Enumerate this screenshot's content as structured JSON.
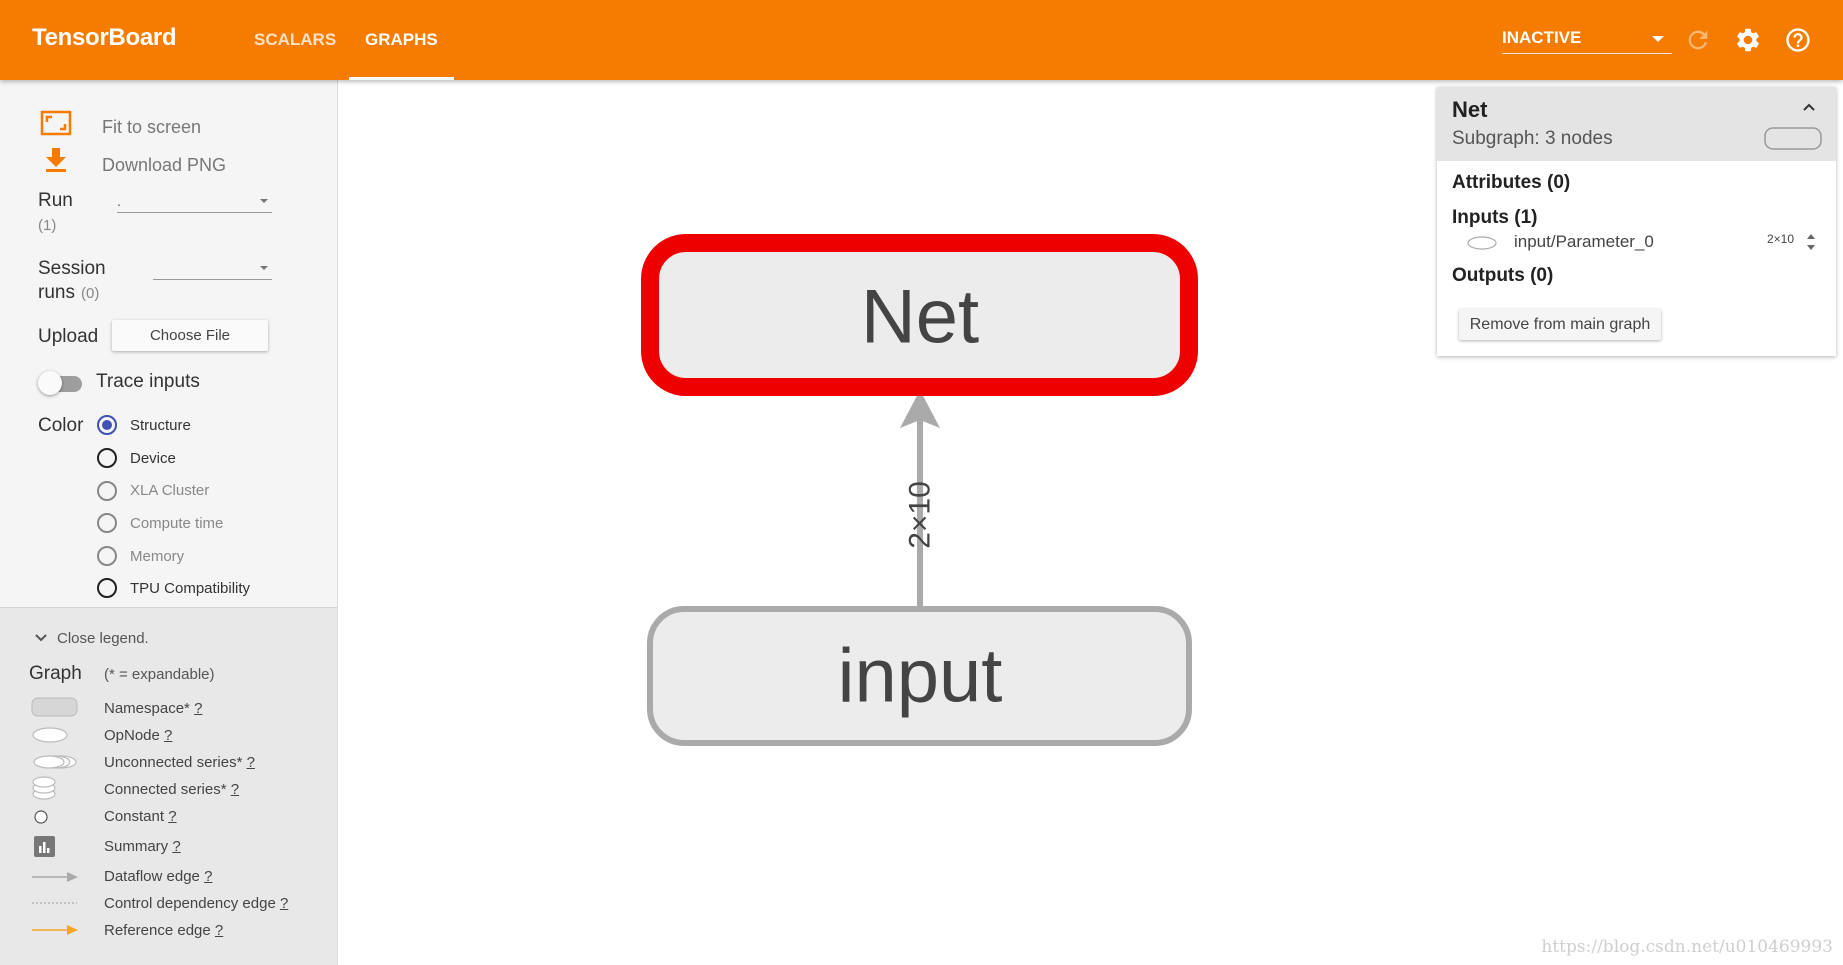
{
  "header": {
    "brand": "TensorBoard",
    "tabs": [
      {
        "label": "SCALARS"
      },
      {
        "label": "GRAPHS"
      }
    ],
    "active_tab": "GRAPHS",
    "status_select": "INACTIVE",
    "bg_color": "#f57c00"
  },
  "sidebar": {
    "fit_to_screen": "Fit to screen",
    "download_png": "Download PNG",
    "run_label": "Run",
    "run_count": "(1)",
    "run_value": ".",
    "session_label_1": "Session",
    "session_label_2": "runs",
    "session_count": "(0)",
    "upload_label": "Upload",
    "choose_file": "Choose File",
    "trace_inputs": "Trace inputs",
    "color_label": "Color",
    "color_options": [
      {
        "label": "Structure",
        "selected": true
      },
      {
        "label": "Device"
      },
      {
        "label": "XLA Cluster"
      },
      {
        "label": "Compute time"
      },
      {
        "label": "Memory"
      },
      {
        "label": "TPU Compatibility"
      }
    ]
  },
  "legend": {
    "close": "Close legend.",
    "graph": "Graph",
    "expandable_note": "(* = expandable)",
    "items": [
      {
        "label": "Namespace*",
        "help": "?"
      },
      {
        "label": "OpNode",
        "help": "?"
      },
      {
        "label": "Unconnected series*",
        "help": "?"
      },
      {
        "label": "Connected series*",
        "help": "?"
      },
      {
        "label": "Constant",
        "help": "?"
      },
      {
        "label": "Summary",
        "help": "?"
      },
      {
        "label": "Dataflow edge",
        "help": "?"
      },
      {
        "label": "Control dependency edge",
        "help": "?"
      },
      {
        "label": "Reference edge",
        "help": "?"
      }
    ]
  },
  "graph": {
    "top_node": "Net",
    "bottom_node": "input",
    "edge_label": "2×10",
    "selected_color": "#ee0000"
  },
  "info_card": {
    "title": "Net",
    "subtitle": "Subgraph: 3 nodes",
    "attributes": "Attributes (0)",
    "inputs": "Inputs (1)",
    "input_name": "input/Parameter_0",
    "input_shape": "2×10",
    "outputs": "Outputs (0)",
    "remove_button": "Remove from main graph"
  },
  "watermark": "https://blog.csdn.net/u010469993"
}
